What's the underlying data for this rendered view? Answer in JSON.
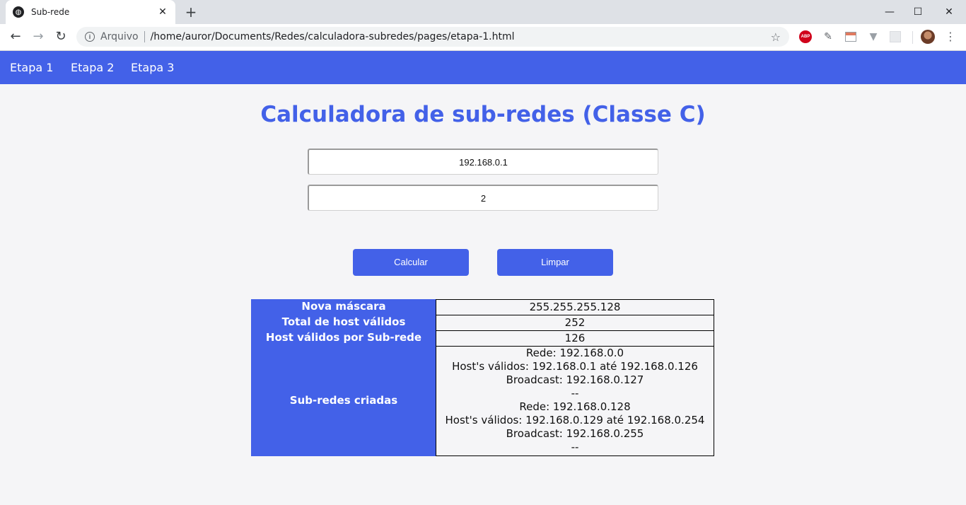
{
  "browser": {
    "tab_title": "Sub-rede",
    "new_tab": "+",
    "url_scheme": "Arquivo",
    "url": "/home/auror/Documents/Redes/calculadora-subredes/pages/etapa-1.html",
    "extension_abp_label": "ABP"
  },
  "nav": {
    "links": [
      "Etapa 1",
      "Etapa 2",
      "Etapa 3"
    ]
  },
  "page": {
    "title": "Calculadora de sub-redes (Classe C)",
    "ip_value": "192.168.0.1",
    "subnets_value": "2",
    "calc_label": "Calcular",
    "clear_label": "Limpar"
  },
  "results": {
    "labels": {
      "mask": "Nova máscara",
      "total_hosts": "Total de host válidos",
      "hosts_per_subnet": "Host válidos por Sub-rede",
      "subnets": "Sub-redes criadas"
    },
    "mask": "255.255.255.128",
    "total_hosts": "252",
    "hosts_per_subnet": "126",
    "subnet_lines": [
      "Rede: 192.168.0.0",
      "Host's válidos: 192.168.0.1 até 192.168.0.126",
      "Broadcast: 192.168.0.127",
      "--",
      "Rede: 192.168.0.128",
      "Host's válidos: 192.168.0.129 até 192.168.0.254",
      "Broadcast: 192.168.0.255",
      "--"
    ]
  },
  "colors": {
    "primary": "#4361e8",
    "background": "#f5f5f7"
  }
}
